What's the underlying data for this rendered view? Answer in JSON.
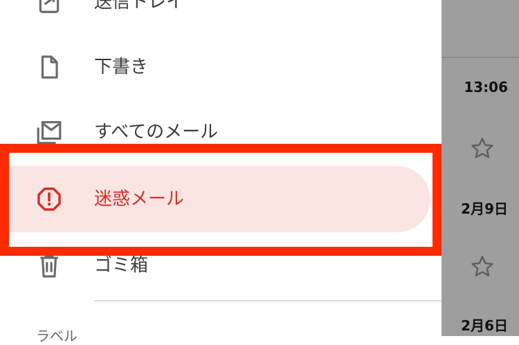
{
  "drawer": {
    "items": [
      {
        "label": "送信トレイ",
        "icon": "outbox-icon"
      },
      {
        "label": "下書き",
        "icon": "draft-icon"
      },
      {
        "label": "すべてのメール",
        "icon": "all-mail-icon"
      },
      {
        "label": "迷惑メール",
        "icon": "spam-icon",
        "active": true
      },
      {
        "label": "ゴミ箱",
        "icon": "trash-icon"
      }
    ],
    "section_label": "ラベル"
  },
  "list": {
    "times": [
      "13:06",
      "2月9日",
      "2月6日"
    ]
  },
  "colors": {
    "active_text": "#d43227",
    "active_bg": "#fbe5e3",
    "highlight": "#ff2a00",
    "overlay": "#9e9e9e"
  }
}
